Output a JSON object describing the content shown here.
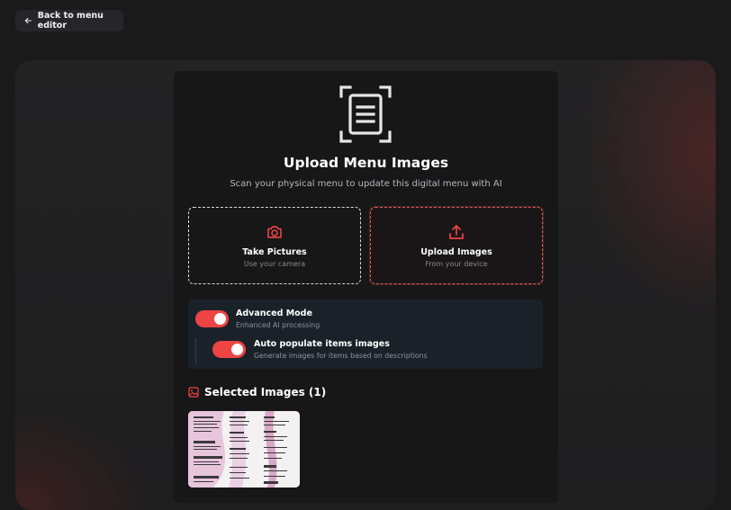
{
  "back_button": {
    "label": "Back to menu editor",
    "icon": "arrow-left-icon"
  },
  "upload": {
    "title": "Upload Menu Images",
    "subtitle": "Scan your physical menu to update this digital menu with AI",
    "icon": "document-scan-icon"
  },
  "options": [
    {
      "label": "Take Pictures",
      "sub": "Use your camera",
      "icon": "camera-icon"
    },
    {
      "label": "Upload Images",
      "sub": "From your device",
      "icon": "upload-icon"
    }
  ],
  "settings": {
    "advanced": {
      "label": "Advanced Mode",
      "sub": "Enhanced AI processing",
      "enabled": true
    },
    "auto_populate": {
      "label": "Auto populate items images",
      "sub": "Generate images for items based on descriptions",
      "enabled": true
    }
  },
  "selected": {
    "title": "Selected Images (1)",
    "icon": "image-icon",
    "count": 1
  },
  "colors": {
    "accent": "#ef4444",
    "panel": "#171718",
    "settings_bg": "#1b2129"
  }
}
